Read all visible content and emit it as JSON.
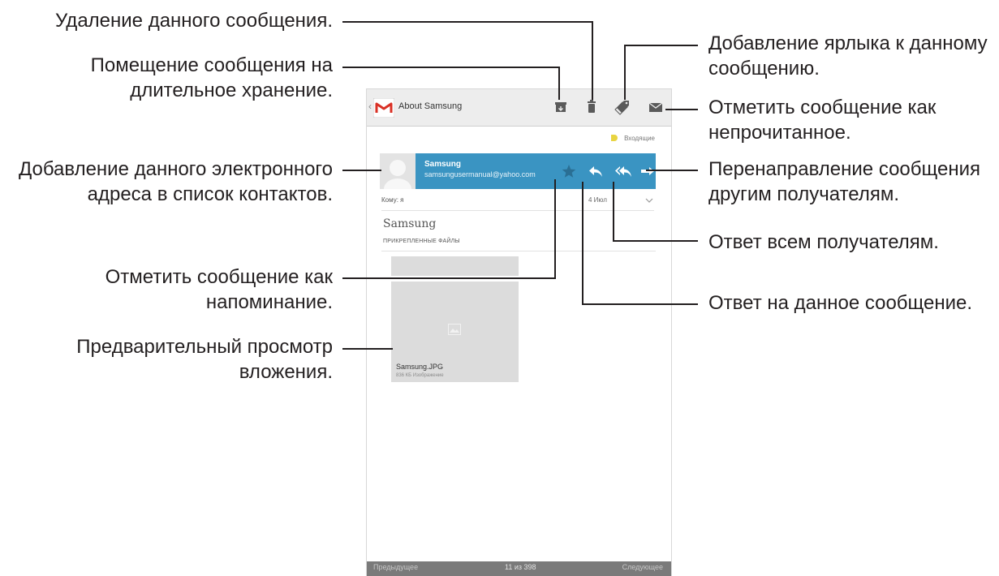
{
  "app": {
    "title": "About Samsung",
    "back_glyph": "‹"
  },
  "action_bar": {
    "icons": [
      "archive-icon",
      "trash-icon",
      "label-tag-icon",
      "mark-unread-envelope-icon"
    ]
  },
  "label_row": {
    "label": "Входящие",
    "tag_color": "#e8d441"
  },
  "sender": {
    "name": "Samsung",
    "email": "samsungusermanual@yahoo.com",
    "bar_color": "#3a94c2",
    "icons": [
      "star-icon",
      "reply-icon",
      "reply-all-icon",
      "forward-icon"
    ]
  },
  "recipient": {
    "to_label": "Кому: я",
    "date": "4 Июл"
  },
  "message": {
    "subject": "Samsung",
    "attachments_header": "ПРИКРЕПЛЕННЫЕ ФАЙЛЫ"
  },
  "attachment": {
    "file_name": "Samsung.JPG",
    "meta": "836 КБ Изображение"
  },
  "bottom_bar": {
    "prev": "Предыдущее",
    "page": "11 из 398",
    "next": "Следующее"
  },
  "callouts": {
    "delete": "Удаление данного сообщения.",
    "archive": [
      "Помещение сообщения на",
      "длительное хранение."
    ],
    "add_contact": [
      "Добавление данного электронного",
      "адреса в список контактов."
    ],
    "reminder": [
      "Отметить сообщение как",
      "напоминание."
    ],
    "preview": [
      "Предварительный просмотр",
      "вложения."
    ],
    "add_label": [
      "Добавление ярлыка к данному",
      "сообщению."
    ],
    "mark_unread": [
      "Отметить сообщение как",
      "непрочитанное."
    ],
    "forward": [
      "Перенаправление сообщения",
      "другим получателям."
    ],
    "reply_all": "Ответ всем получателям.",
    "reply": "Ответ на данное сообщение."
  },
  "colors": {
    "accent": "#3a94c2",
    "callout_text": "#231f20",
    "connector": "#231f20"
  }
}
